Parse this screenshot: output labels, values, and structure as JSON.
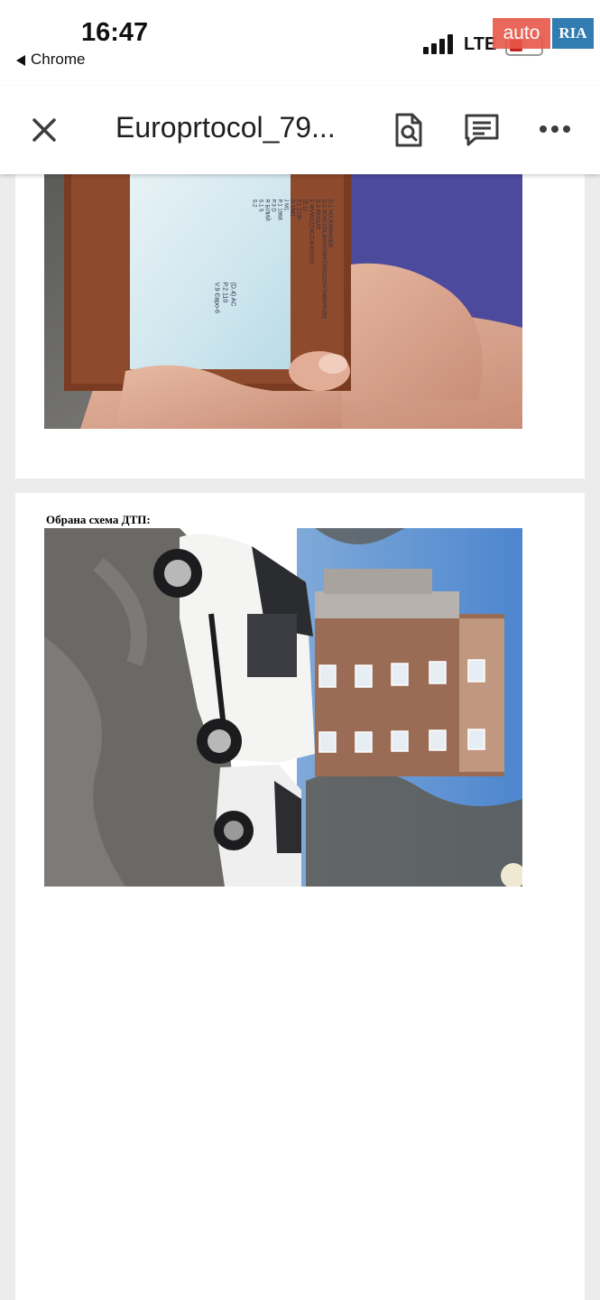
{
  "status_bar": {
    "time": "16:47",
    "back_app_label": "Chrome",
    "network": "LTE",
    "signal_icon": "cellular-signal-icon",
    "battery_icon": "battery-low-icon",
    "colors": {
      "battery_low": "#c21f1f"
    }
  },
  "watermark": {
    "left": "auto",
    "right": "RIA"
  },
  "toolbar": {
    "title": "Europrtocol_79...",
    "close_icon": "close-icon",
    "find_icon": "find-in-document-icon",
    "comment_icon": "comment-icon",
    "more_icon": "more-horizontal-icon"
  },
  "document": {
    "pages": [
      {
        "image": "vehicle-registration-document-photo",
        "registration_card": {
          "lines": [
            "D.1  VOLKSWAGEN",
            "D.2  3CACCRLBX0/F0WFD0/0022SVTMMVR/262",
            "D.3  PASSAT",
            "E    WVWZZZ3CZHE301002",
            "(E.1)",
            "F.1  2130",
            "G    1541",
            "J    M1",
            "P.1  1968",
            "P.3  D",
            "R    БІЛИЙ",
            "S.1  5",
            "S.2"
          ],
          "right_lines": [
            "(D.4) AC",
            "P.2  110",
            "V.9  Євро-6"
          ]
        }
      },
      {
        "caption": "Обрана схема ДТП:",
        "image": "accident-scene-photo"
      }
    ]
  }
}
